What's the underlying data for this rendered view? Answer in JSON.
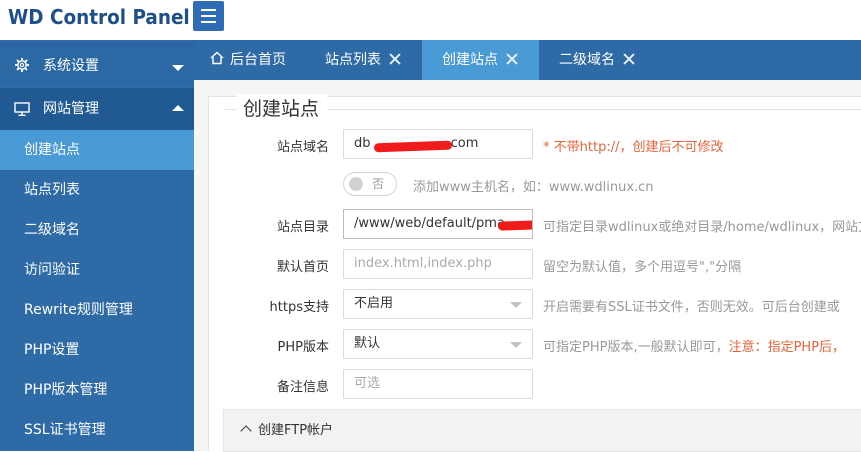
{
  "app": {
    "title": "WD Control Panel"
  },
  "sidebar": {
    "settings_label": "系统设置",
    "website_label": "网站管理",
    "items": [
      {
        "label": "创建站点",
        "active": true
      },
      {
        "label": "站点列表",
        "active": false
      },
      {
        "label": "二级域名",
        "active": false
      },
      {
        "label": "访问验证",
        "active": false
      },
      {
        "label": "Rewrite规则管理",
        "active": false
      },
      {
        "label": "PHP设置",
        "active": false
      },
      {
        "label": "PHP版本管理",
        "active": false
      },
      {
        "label": "SSL证书管理",
        "active": false
      }
    ]
  },
  "tabs": [
    {
      "label": "后台首页",
      "closable": false,
      "active": false,
      "icon": "home-icon"
    },
    {
      "label": "站点列表",
      "closable": true,
      "active": false
    },
    {
      "label": "创建站点",
      "closable": true,
      "active": true
    },
    {
      "label": "二级域名",
      "closable": true,
      "active": false
    }
  ],
  "form": {
    "title": "创建站点",
    "domain": {
      "label": "站点域名",
      "value_start": "db",
      "value_end": ".com",
      "hint": "* 不带http://，创建后不可修改"
    },
    "www": {
      "toggle_label": "否",
      "hint": "添加www主机名，如：www.wdlinux.cn"
    },
    "dir": {
      "label": "站点目录",
      "value": "/www/web/default/pma_",
      "hint": "可指定目录wdlinux或绝对目录/home/wdlinux，网站文"
    },
    "index": {
      "label": "默认首页",
      "placeholder": "index.html,index.php",
      "hint": "留空为默认值，多个用逗号\",\"分隔"
    },
    "https": {
      "label": "https支持",
      "value": "不启用",
      "hint": "开启需要有SSL证书文件，否则无效。可后台创建或"
    },
    "php": {
      "label": "PHP版本",
      "value": "默认",
      "hint": "可指定PHP版本,一般默认即可，",
      "warn": "注意：指定PHP后，"
    },
    "note": {
      "label": "备注信息",
      "placeholder": "可选"
    },
    "ftp": {
      "label": "创建FTP帐户"
    }
  },
  "colors": {
    "brand": "#1f4f8a",
    "sidebar": "#2d6aa6",
    "active": "#4a9ad6",
    "warning": "#e8643b"
  }
}
